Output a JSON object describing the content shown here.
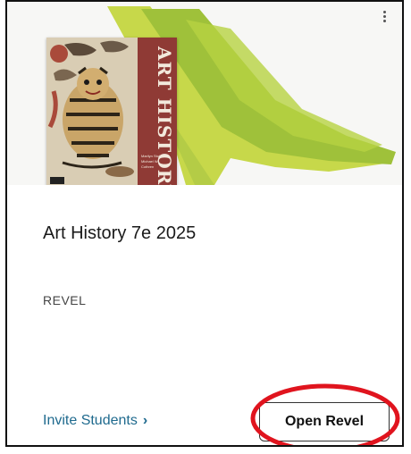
{
  "course": {
    "title": "Art History 7e 2025",
    "product": "REVEL"
  },
  "cover": {
    "spine_title": "ART HISTORY",
    "authors": "Marilyn Stokstad · Michael W. Cothren"
  },
  "actions": {
    "invite_label": "Invite Students",
    "open_label": "Open Revel"
  },
  "colors": {
    "link": "#1f6a8e",
    "highlight_ring": "#e0141e",
    "swoosh_light": "#c8d94a",
    "swoosh_dark": "#8fb52e"
  },
  "icons": {
    "menu": "kebab-menu-icon",
    "invite_chevron": "chevron-right-icon"
  }
}
